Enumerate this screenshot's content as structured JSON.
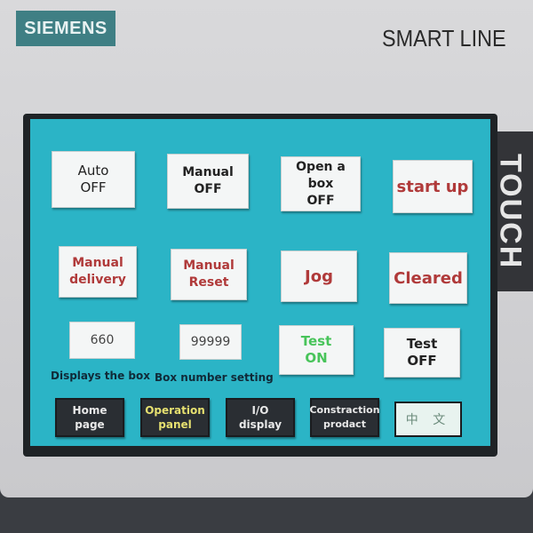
{
  "device": {
    "brand": "SIEMENS",
    "model": "SMART LINE",
    "side_label": "TOUCH"
  },
  "colors": {
    "screen": "#2bb4c6",
    "button_red_text": "#b03a3a",
    "test_on_text": "#48c45a",
    "active_nav_text": "#e6e070"
  },
  "buttons": {
    "auto": [
      "Auto",
      "OFF"
    ],
    "manual": [
      "Manual",
      "OFF"
    ],
    "open_box": [
      "Open a box",
      "OFF"
    ],
    "start_up": "start up",
    "manual_delivery": [
      "Manual",
      "delivery"
    ],
    "manual_reset": [
      "Manual",
      "Reset"
    ],
    "jog": "Jog",
    "cleared": "Cleared",
    "test_on": [
      "Test",
      "ON"
    ],
    "test_off": [
      "Test",
      "OFF"
    ]
  },
  "fields": {
    "displays_box": {
      "value": "660",
      "label": "Displays the box"
    },
    "box_number": {
      "value": "99999",
      "label": "Box number setting"
    }
  },
  "nav": [
    {
      "l1": "Home",
      "l2": "page"
    },
    {
      "l1": "Operation",
      "l2": "panel",
      "active": true
    },
    {
      "l1": "I/O",
      "l2": "display"
    },
    {
      "l1": "Constraction",
      "l2": "prodact"
    }
  ],
  "language_button": "中 文"
}
